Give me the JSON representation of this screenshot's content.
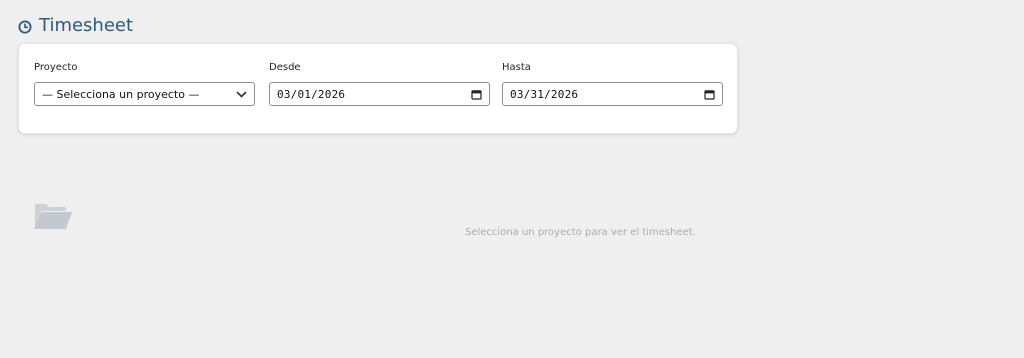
{
  "header": {
    "title": "Timesheet",
    "icon": "clock-icon"
  },
  "filters": {
    "project": {
      "label": "Proyecto",
      "selected": "— Selecciona un proyecto —"
    },
    "from": {
      "label": "Desde",
      "value": "03/01/2026"
    },
    "to": {
      "label": "Hasta",
      "value": "03/31/2026"
    }
  },
  "empty_state": {
    "icon": "folder-open-icon",
    "message": "Selecciona un proyecto para ver el timesheet."
  },
  "colors": {
    "title": "#2c5b7e",
    "background": "#efefef",
    "card": "#ffffff",
    "muted_text": "#a9acaf"
  }
}
